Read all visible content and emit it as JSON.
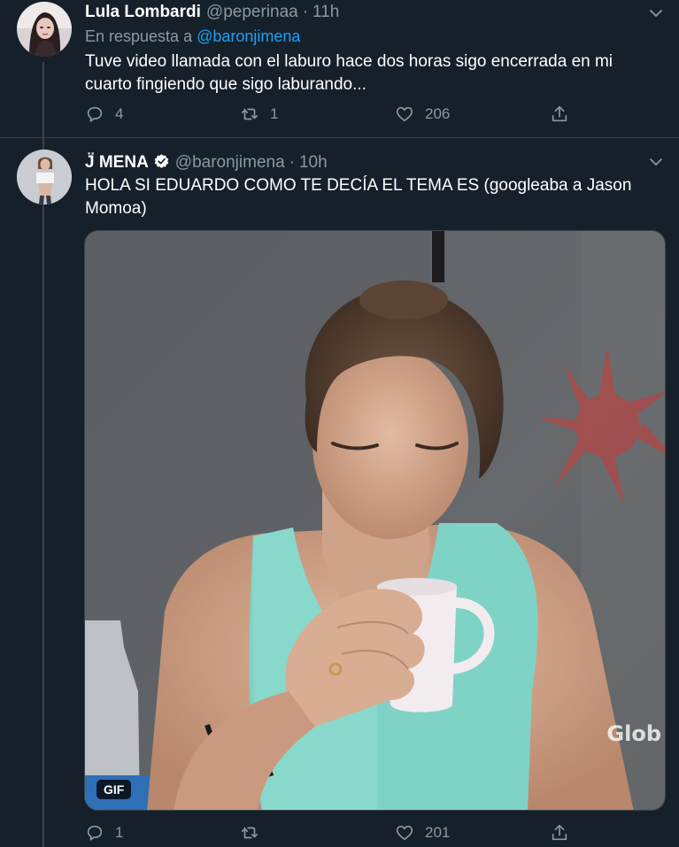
{
  "tweets": [
    {
      "name": "Lula Lombardi",
      "handle": "@peperinaa",
      "dot": "·",
      "time": "11h",
      "reply_prefix": "En respuesta a",
      "reply_mention": "@baronjimena",
      "text": "Tuve video llamada con el laburo hace dos horas sigo encerrada en mi cuarto fingiendo que sigo laburando...",
      "replies": "4",
      "retweets": "1",
      "likes": "206"
    },
    {
      "name": "J̈ MENA",
      "handle": "@baronjimena",
      "dot": "·",
      "time": "10h",
      "verified": true,
      "text": "HOLA SI EDUARDO COMO TE DECÍA EL TEMA ES (googleaba a Jason Momoa)",
      "media": {
        "type": "gif",
        "badge": "GIF",
        "watermark": "Glob"
      },
      "replies": "1",
      "retweets": "",
      "likes": "201"
    }
  ],
  "icons": {
    "reply": "speech-bubble-icon",
    "retweet": "retweet-arrows-icon",
    "like": "heart-icon",
    "share": "share-upload-icon",
    "more": "chevron-down-icon",
    "verified": "verified-badge-icon"
  },
  "colors": {
    "background": "#15202b",
    "text": "#ffffff",
    "secondary": "#8899a6",
    "accent": "#1da1f2",
    "border": "#38444d"
  }
}
